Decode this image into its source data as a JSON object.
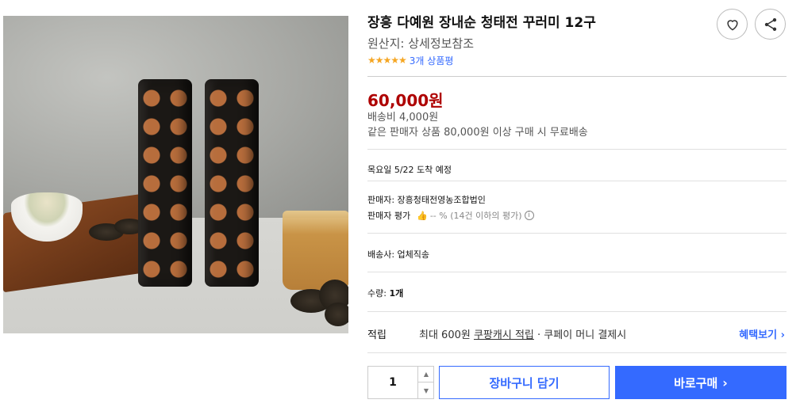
{
  "product": {
    "title": "장흥 다예원 장내순 청태전 꾸러미 12구",
    "origin": "원산지: 상세정보참조",
    "stars": "★★★★★",
    "review_count": "3개 상품평",
    "rating": 5
  },
  "actions": {
    "favorite_icon": "heart-icon",
    "share_icon": "share-icon"
  },
  "pricing": {
    "price": "60,000원",
    "shipping_fee": "배송비 4,000원",
    "free_shipping_note": "같은 판매자 상품 80,000원 이상 구매 시 무료배송"
  },
  "delivery": {
    "arrival": "목요일 5/22 도착 예정",
    "seller": "판매자: 장흥청태전영농조합법인",
    "seller_rating_label": "판매자 평가",
    "seller_rating_value": "-- % (14건 이하의 평가)",
    "courier": "배송사: 업체직송"
  },
  "quantity": {
    "label": "수량:",
    "value_text": "1개",
    "stepper_value": "1",
    "up_glyph": "▲",
    "down_glyph": "▼"
  },
  "points": {
    "label": "적립",
    "prefix": "최대 600원 ",
    "link": "쿠팡캐시 적립",
    "suffix": " · 쿠페이 머니 결제시",
    "benefit": "혜택보기 ›"
  },
  "buttons": {
    "cart": "장바구니 담기",
    "buy": "바로구매",
    "buy_chevron": "›"
  },
  "colors": {
    "price": "#ae0000",
    "accent": "#346aff",
    "stars": "#f5a623"
  }
}
